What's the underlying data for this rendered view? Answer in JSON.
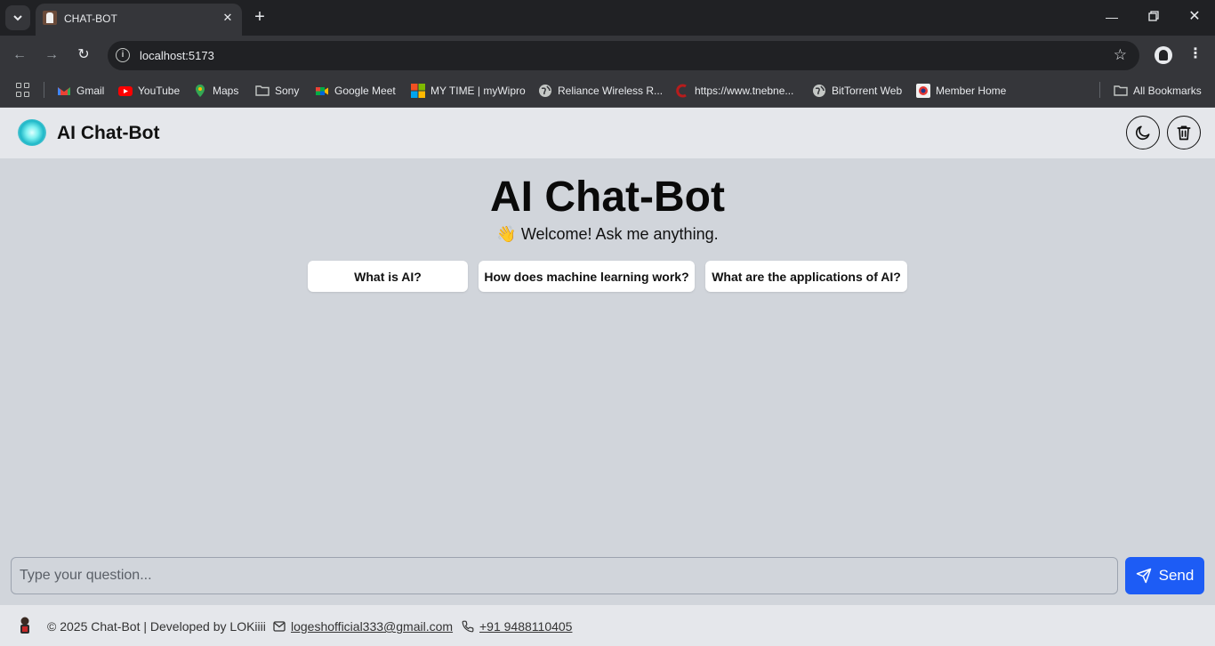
{
  "browser": {
    "tab_title": "CHAT-BOT",
    "url": "localhost:5173",
    "bookmarks": [
      {
        "label": "Gmail",
        "icon": "gmail-icon",
        "color": "#ea4335"
      },
      {
        "label": "YouTube",
        "icon": "youtube-icon",
        "color": "#ff0000"
      },
      {
        "label": "Maps",
        "icon": "maps-icon",
        "color": "#34a853"
      },
      {
        "label": "Sony",
        "icon": "folder-icon",
        "color": "#c4c7c5"
      },
      {
        "label": "Google Meet",
        "icon": "google-meet-icon",
        "color": "#00ac47"
      },
      {
        "label": "MY TIME | myWipro",
        "icon": "microsoft-icon",
        "color": "#f25022"
      },
      {
        "label": "Reliance Wireless R...",
        "icon": "globe-icon",
        "color": "#c4c7c5"
      },
      {
        "label": "https://www.tnebne...",
        "icon": "tneb-icon",
        "color": "#b71c1c"
      },
      {
        "label": "BitTorrent Web",
        "icon": "globe-icon",
        "color": "#c4c7c5"
      },
      {
        "label": "Member Home",
        "icon": "member-home-icon",
        "color": "#e53935"
      }
    ],
    "all_bookmarks": "All Bookmarks"
  },
  "app": {
    "title": "AI Chat-Bot",
    "hero_title": "AI Chat-Bot",
    "welcome": "👋 Welcome! Ask me anything.",
    "suggestions": [
      "What is AI?",
      "How does machine learning work?",
      "What are the applications of AI?"
    ],
    "input_placeholder": "Type your question...",
    "send_label": "Send",
    "accent": "#1d5cf5"
  },
  "footer": {
    "text": "© 2025 Chat-Bot | Developed by LOKiiii",
    "email": "logeshofficial333@gmail.com",
    "phone": "+91 9488110405"
  }
}
